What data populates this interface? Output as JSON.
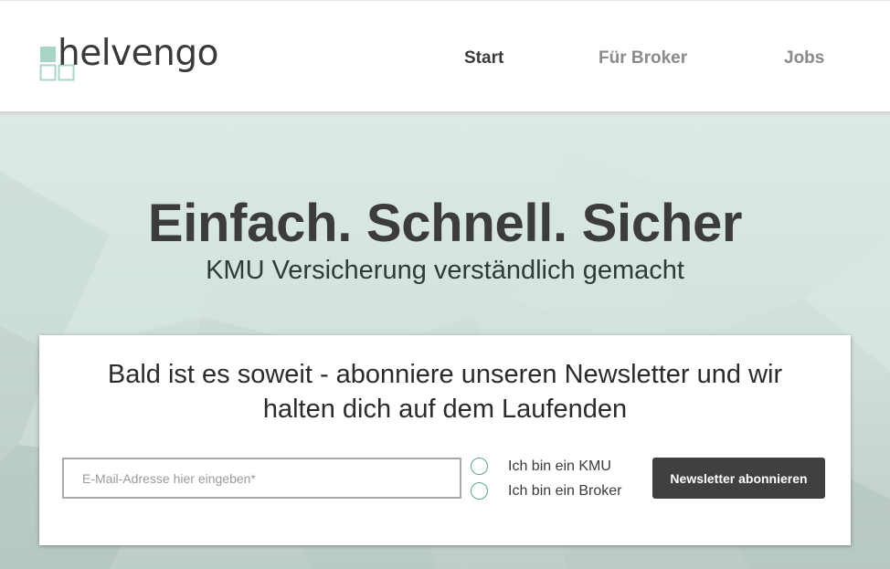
{
  "header": {
    "logo_text": "helvengo",
    "nav": [
      {
        "label": "Start",
        "active": true
      },
      {
        "label": "Für Broker",
        "active": false
      },
      {
        "label": "Jobs",
        "active": false
      }
    ]
  },
  "hero": {
    "title": "Einfach. Schnell. Sicher",
    "subtitle": "KMU Versicherung verständlich gemacht"
  },
  "newsletter": {
    "heading_line1": "Bald ist es soweit - abonniere unseren Newsletter und wir",
    "heading_line2": "halten dich auf dem Laufenden",
    "email_placeholder": "E-Mail-Adresse hier eingeben*",
    "email_value": "",
    "options": [
      "Ich bin ein KMU",
      "Ich bin ein Broker"
    ],
    "button_label": "Newsletter abonnieren"
  },
  "colors": {
    "accent": "#a8d5c8",
    "button_bg": "#404040",
    "radio_border": "#5fa596",
    "hero_bg": "#d3e2dc"
  }
}
